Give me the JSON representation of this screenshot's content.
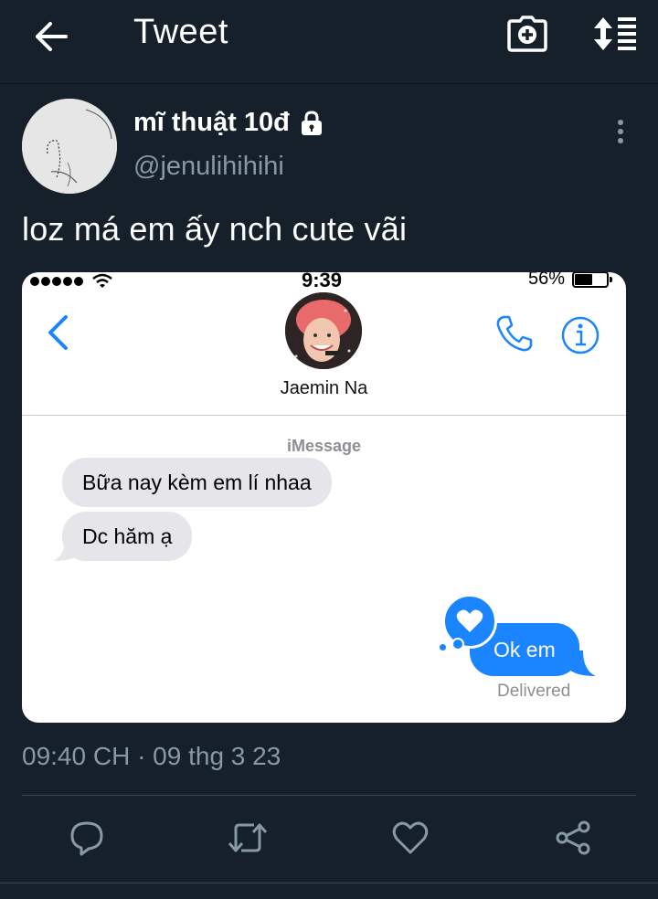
{
  "header": {
    "title": "Tweet",
    "back_icon": "arrow-left-icon",
    "camera_icon": "camera-plus-icon",
    "sort_icon": "sort-lines-icon"
  },
  "author": {
    "display_name": "mĩ thuật 10đ",
    "handle": "@jenulihihihi",
    "protected_icon": "lock-icon"
  },
  "tweet": {
    "text": "loz má em ấy nch cute vãi",
    "timestamp": "09:40 CH · 09 thg 3 23"
  },
  "screenshot": {
    "status_bar": {
      "time": "9:39",
      "battery": "56%",
      "battery_level": 0.56
    },
    "contact_name": "Jaemin Na",
    "service_label": "iMessage",
    "messages": [
      {
        "direction": "incoming",
        "text": "Bữa nay kèm em lí nhaa"
      },
      {
        "direction": "incoming",
        "text": "Dc hăm ạ"
      },
      {
        "direction": "outgoing",
        "text": "Ok em"
      }
    ],
    "delivery_status": "Delivered"
  },
  "actions": [
    "reply-icon",
    "retweet-icon",
    "like-icon",
    "share-icon"
  ],
  "colors": {
    "background": "#15202b",
    "secondary_text": "#8899a6",
    "imessage_blue": "#1b84ff",
    "incoming_bubble": "#e5e5ea"
  }
}
